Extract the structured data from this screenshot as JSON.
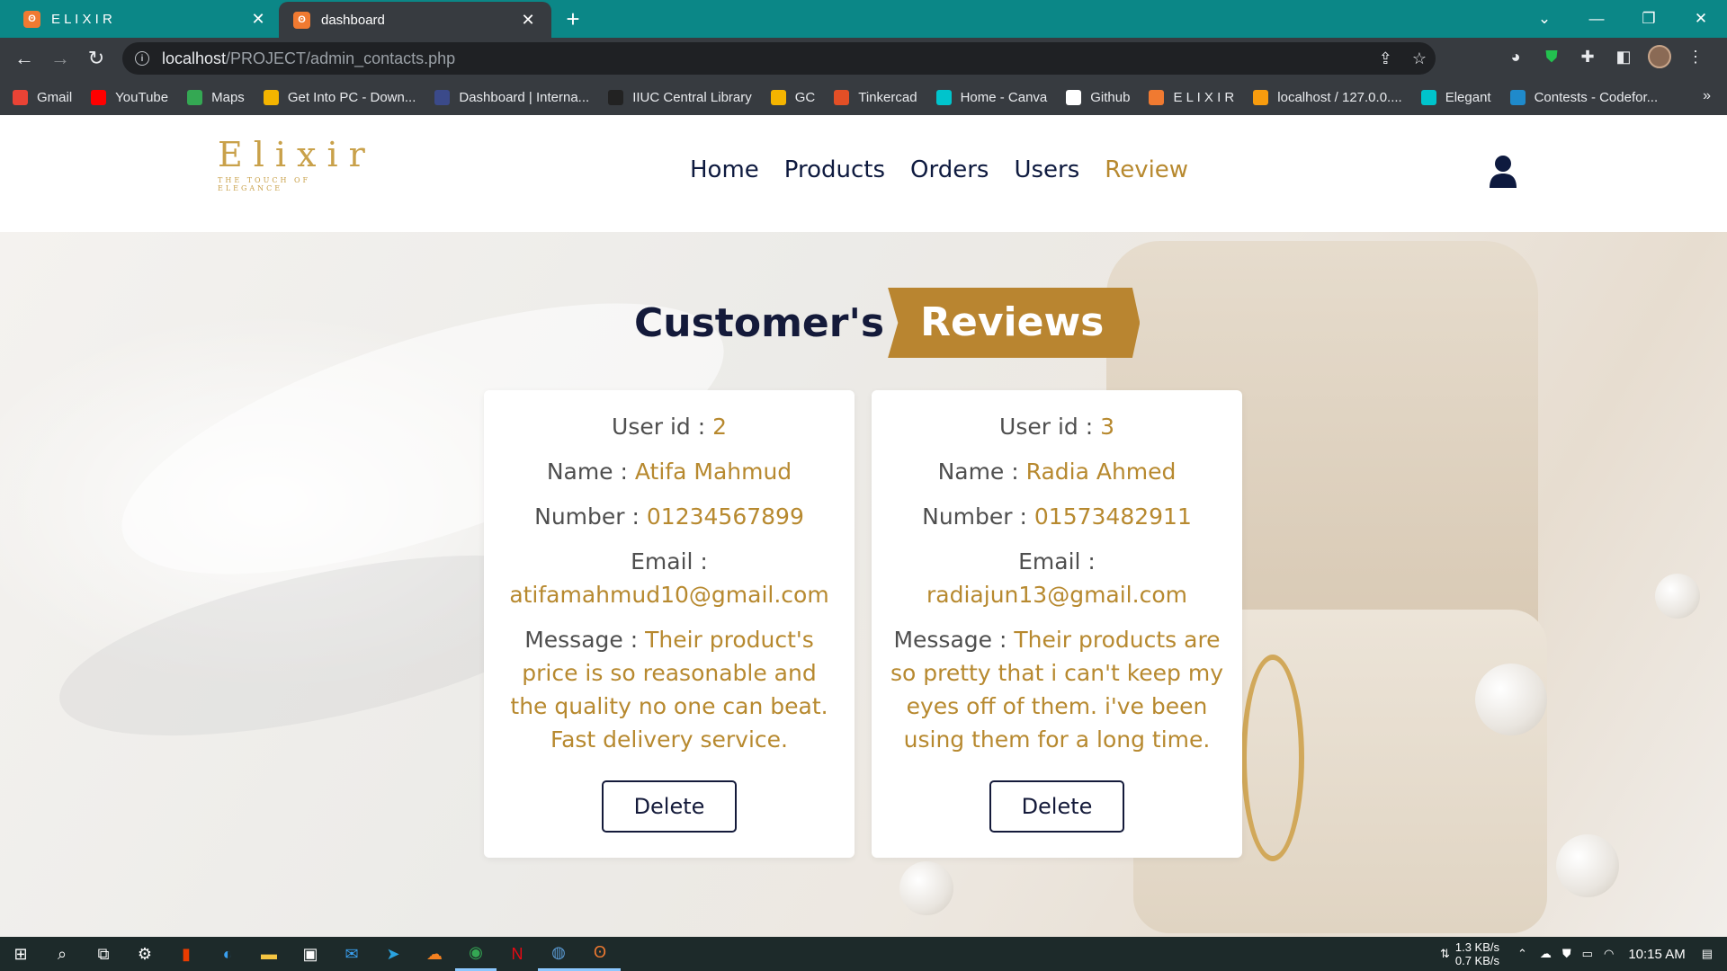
{
  "browser": {
    "tabs": [
      {
        "title": "E L I X I R",
        "active": false
      },
      {
        "title": "dashboard",
        "active": true
      }
    ],
    "url_host": "localhost",
    "url_path": "/PROJECT/admin_contacts.php",
    "bookmarks": [
      {
        "label": "Gmail",
        "icon": "gmail-icon",
        "color": "#ea4335"
      },
      {
        "label": "YouTube",
        "icon": "youtube-icon",
        "color": "#ff0000"
      },
      {
        "label": "Maps",
        "icon": "maps-icon",
        "color": "#34a853"
      },
      {
        "label": "Get Into PC - Down...",
        "icon": "getintopc-icon",
        "color": "#f4b400"
      },
      {
        "label": "Dashboard | Interna...",
        "icon": "university-icon",
        "color": "#3b4a8a"
      },
      {
        "label": "IIUC Central Library",
        "icon": "library-icon",
        "color": "#222222"
      },
      {
        "label": "GC",
        "icon": "classroom-icon",
        "color": "#f4b400"
      },
      {
        "label": "Tinkercad",
        "icon": "tinkercad-icon",
        "color": "#e34f26"
      },
      {
        "label": "Home - Canva",
        "icon": "canva-icon",
        "color": "#00c4cc"
      },
      {
        "label": "Github",
        "icon": "github-icon",
        "color": "#ffffff"
      },
      {
        "label": "E L I X I R",
        "icon": "xampp-icon",
        "color": "#f07a31"
      },
      {
        "label": "localhost / 127.0.0....",
        "icon": "phpmyadmin-icon",
        "color": "#f89c0e"
      },
      {
        "label": "Elegant",
        "icon": "canva-icon",
        "color": "#00c4cc"
      },
      {
        "label": "Contests - Codefor...",
        "icon": "codeforces-icon",
        "color": "#1f8acb"
      }
    ]
  },
  "site": {
    "logo_text": "Elixir",
    "logo_tagline": "THE TOUCH OF ELEGANCE",
    "nav": [
      {
        "label": "Home",
        "active": false
      },
      {
        "label": "Products",
        "active": false
      },
      {
        "label": "Orders",
        "active": false
      },
      {
        "label": "Users",
        "active": false
      },
      {
        "label": "Review",
        "active": true
      }
    ],
    "heading_part1": "Customer's",
    "heading_part2": "Reviews",
    "accent_color": "#b7892f",
    "dark_color": "#141a3a"
  },
  "reviews": [
    {
      "user_id_label": "User id : ",
      "user_id": "2",
      "name_label": "Name : ",
      "name": "Atifa Mahmud",
      "number_label": "Number : ",
      "number": "01234567899",
      "email_label": "Email :",
      "email": "atifamahmud10@gmail.com",
      "message_label": "Message : ",
      "message": "Their product's price is so reasonable and the quality no one can beat. Fast delivery service.",
      "delete_label": "Delete"
    },
    {
      "user_id_label": "User id : ",
      "user_id": "3",
      "name_label": "Name : ",
      "name": "Radia Ahmed",
      "number_label": "Number : ",
      "number": "01573482911",
      "email_label": "Email :",
      "email": "radiajun13@gmail.com",
      "message_label": "Message : ",
      "message": "Their products are so pretty that i can't keep my eyes off of them. i've been using them for a long time.",
      "delete_label": "Delete"
    }
  ],
  "taskbar": {
    "net_down": "1.3 KB/s",
    "net_up": "0.7 KB/s",
    "time": "10:15 AM"
  }
}
